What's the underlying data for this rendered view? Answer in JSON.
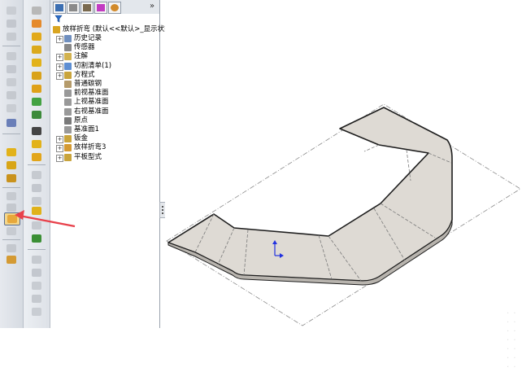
{
  "tree": {
    "root_label": "放样折弯 (默认<<默认>_显示状态",
    "items": [
      {
        "label": "历史记录",
        "expandable": true
      },
      {
        "label": "传感器",
        "expandable": false
      },
      {
        "label": "注解",
        "expandable": true
      },
      {
        "label": "切割清单(1)",
        "expandable": true
      },
      {
        "label": "方程式",
        "expandable": true
      },
      {
        "label": "普通碳钢",
        "expandable": false
      },
      {
        "label": "前视基准面",
        "expandable": false
      },
      {
        "label": "上视基准面",
        "expandable": false
      },
      {
        "label": "右视基准面",
        "expandable": false
      },
      {
        "label": "原点",
        "expandable": false
      },
      {
        "label": "基准面1",
        "expandable": false
      },
      {
        "label": "钣金",
        "expandable": true
      },
      {
        "label": "放样折弯3",
        "expandable": true
      },
      {
        "label": "平板型式",
        "expandable": true
      }
    ]
  },
  "colors": {
    "part_face": "#dedad4",
    "part_edge": "#1e1e1e",
    "arrow": "#e8414b",
    "axis_blue": "#2030e0"
  },
  "icons": {
    "filter": "filter-icon",
    "tabs": [
      "feature-manager-icon",
      "property-manager-icon",
      "configuration-manager-icon",
      "dimxpert-icon",
      "display-manager-icon"
    ]
  }
}
